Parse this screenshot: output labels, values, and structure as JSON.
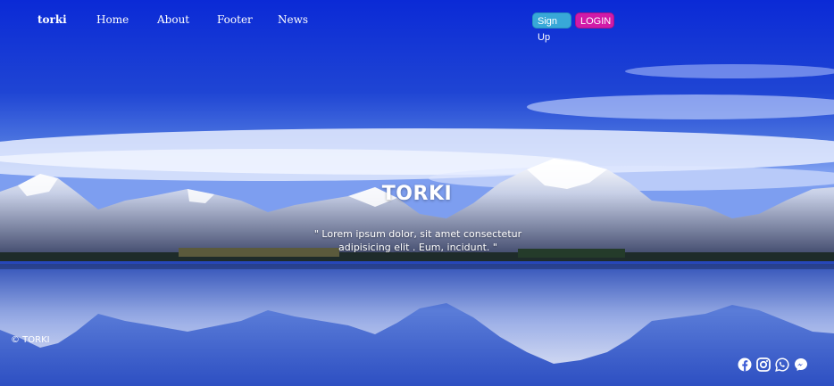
{
  "nav": {
    "brand": "torki",
    "links": [
      "Home",
      "About",
      "Footer",
      "News"
    ],
    "signup_label": "Sign Up",
    "login_label": "LOGIN"
  },
  "hero": {
    "title": "TORKI",
    "subtitle": "\" Lorem ipsum dolor, sit amet consectetur adipisicing elit . Eum, incidunt. \""
  },
  "footer": {
    "copyright": "© TORKI",
    "social_icons": [
      "facebook-icon",
      "instagram-icon",
      "whatsapp-icon",
      "messenger-icon"
    ]
  },
  "colors": {
    "signup": "#38a8d8",
    "login": "#d11aa8",
    "sky": "#1f3fd0"
  }
}
